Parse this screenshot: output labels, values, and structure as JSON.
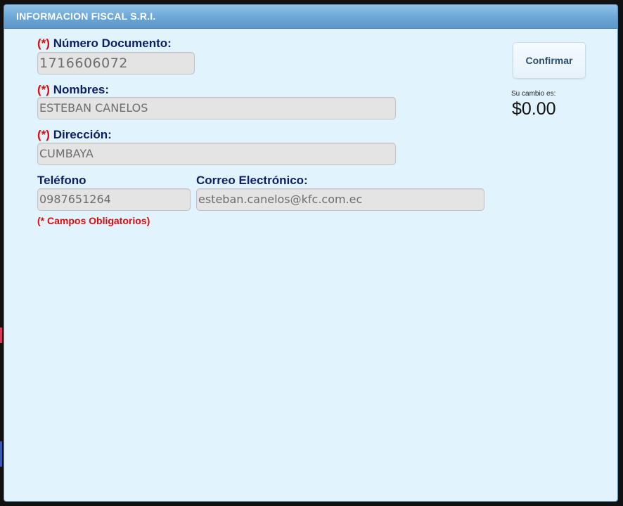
{
  "window": {
    "title": "INFORMACION FISCAL S.R.I."
  },
  "form": {
    "required_marker": "(*)",
    "documento": {
      "label": "Número Documento:",
      "value": "1716606072"
    },
    "nombres": {
      "label": "Nombres:",
      "value": "ESTEBAN CANELOS"
    },
    "direccion": {
      "label": "Dirección:",
      "value": "CUMBAYA"
    },
    "telefono": {
      "label": "Teléfono",
      "value": "0987651264"
    },
    "correo": {
      "label": "Correo Electrónico:",
      "value": "esteban.canelos@kfc.com.ec"
    },
    "note": "(* Campos Obligatorios)"
  },
  "actions": {
    "confirm_label": "Confirmar"
  },
  "change": {
    "label": "Su cambio es:",
    "value": "$0.00"
  },
  "colors": {
    "title_bar": "#6ba6d6",
    "panel_bg": "#e1f3fd",
    "label_text": "#0b1e6b",
    "required": "#dc0a0a"
  }
}
